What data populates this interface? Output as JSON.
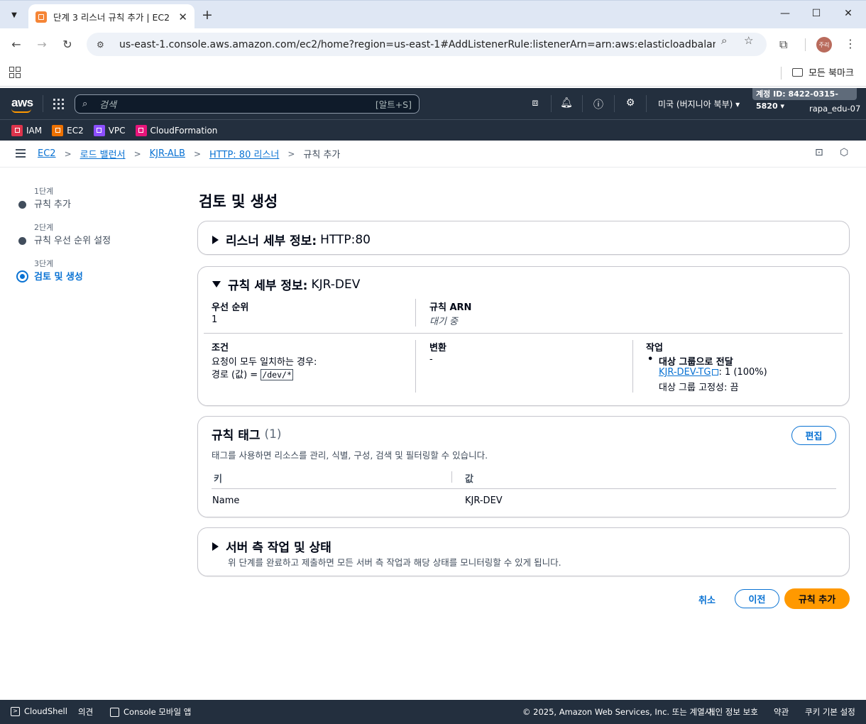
{
  "browser": {
    "tab_title": "단계 3 리스너 규칙 추가 | EC2",
    "url": "us-east-1.console.aws.amazon.com/ec2/home?region=us-east-1#AddListenerRule:listenerArn=arn:aws:elasticloadbalancing:us-east-...",
    "profile_label": "주리",
    "all_bookmarks": "모든 북마크"
  },
  "aws_header": {
    "logo": "aws",
    "search_placeholder": "검색",
    "search_shortcut": "[알트+S]",
    "region": "미국 (버지니아 북부) ▾",
    "account": "계정 ID: 8422-0315-5820 ▾",
    "user": "rapa_edu-07"
  },
  "services": [
    {
      "label": "IAM",
      "color": "#dd344c"
    },
    {
      "label": "EC2",
      "color": "#ed7100"
    },
    {
      "label": "VPC",
      "color": "#8c4fff"
    },
    {
      "label": "CloudFormation",
      "color": "#e7157b"
    }
  ],
  "breadcrumbs": {
    "links": [
      "EC2",
      "로드 밸런서",
      "KJR-ALB",
      "HTTP: 80 리스너"
    ],
    "current": "규칙 추가"
  },
  "steps": [
    {
      "num": "1단계",
      "title": "규칙 추가"
    },
    {
      "num": "2단계",
      "title": "규칙 우선 순위 설정"
    },
    {
      "num": "3단계",
      "title": "검토 및 생성"
    }
  ],
  "page_title": "검토 및 생성",
  "listener_section": {
    "title": "리스너 세부 정보:",
    "value": "HTTP:80"
  },
  "rule_section": {
    "title": "규칙 세부 정보:",
    "value": "KJR-DEV",
    "priority_label": "우선 순위",
    "priority_value": "1",
    "arn_label": "규칙 ARN",
    "arn_value": "대기 중",
    "condition_label": "조건",
    "condition_line1": "요청이 모두 일치하는 경우:",
    "condition_path_prefix": "경로 (값) =",
    "condition_path_value": "/dev/*",
    "transform_label": "변환",
    "transform_value": "-",
    "action_label": "작업",
    "action_title": "대상 그룹으로 전달",
    "action_tg_link": "KJR-DEV-TG",
    "action_tg_weight": ": 1 (100%)",
    "action_stickiness": "대상 그룹 고정성: 끔"
  },
  "tags_section": {
    "title": "규칙 태그",
    "count": "(1)",
    "description": "태그를 사용하면 리소스를 관리, 식별, 구성, 검색 및 필터링할 수 있습니다.",
    "edit_label": "편집",
    "col_key": "키",
    "col_value": "값",
    "rows": [
      {
        "key": "Name",
        "value": "KJR-DEV"
      }
    ]
  },
  "server_section": {
    "title": "서버 측 작업 및 상태",
    "description": "위 단계를 완료하고 제출하면 모든 서버 측 작업과 해당 상태를 모니터링할 수 있게 됩니다."
  },
  "actions": {
    "cancel": "취소",
    "previous": "이전",
    "submit": "규칙 추가"
  },
  "footer": {
    "cloudshell": "CloudShell",
    "feedback": "의견",
    "mobile": "Console 모바일 앱",
    "copyright": "© 2025, Amazon Web Services, Inc. 또는 계열사.",
    "privacy": "개인 정보 보호",
    "terms": "약관",
    "cookies": "쿠키 기본 설정"
  }
}
